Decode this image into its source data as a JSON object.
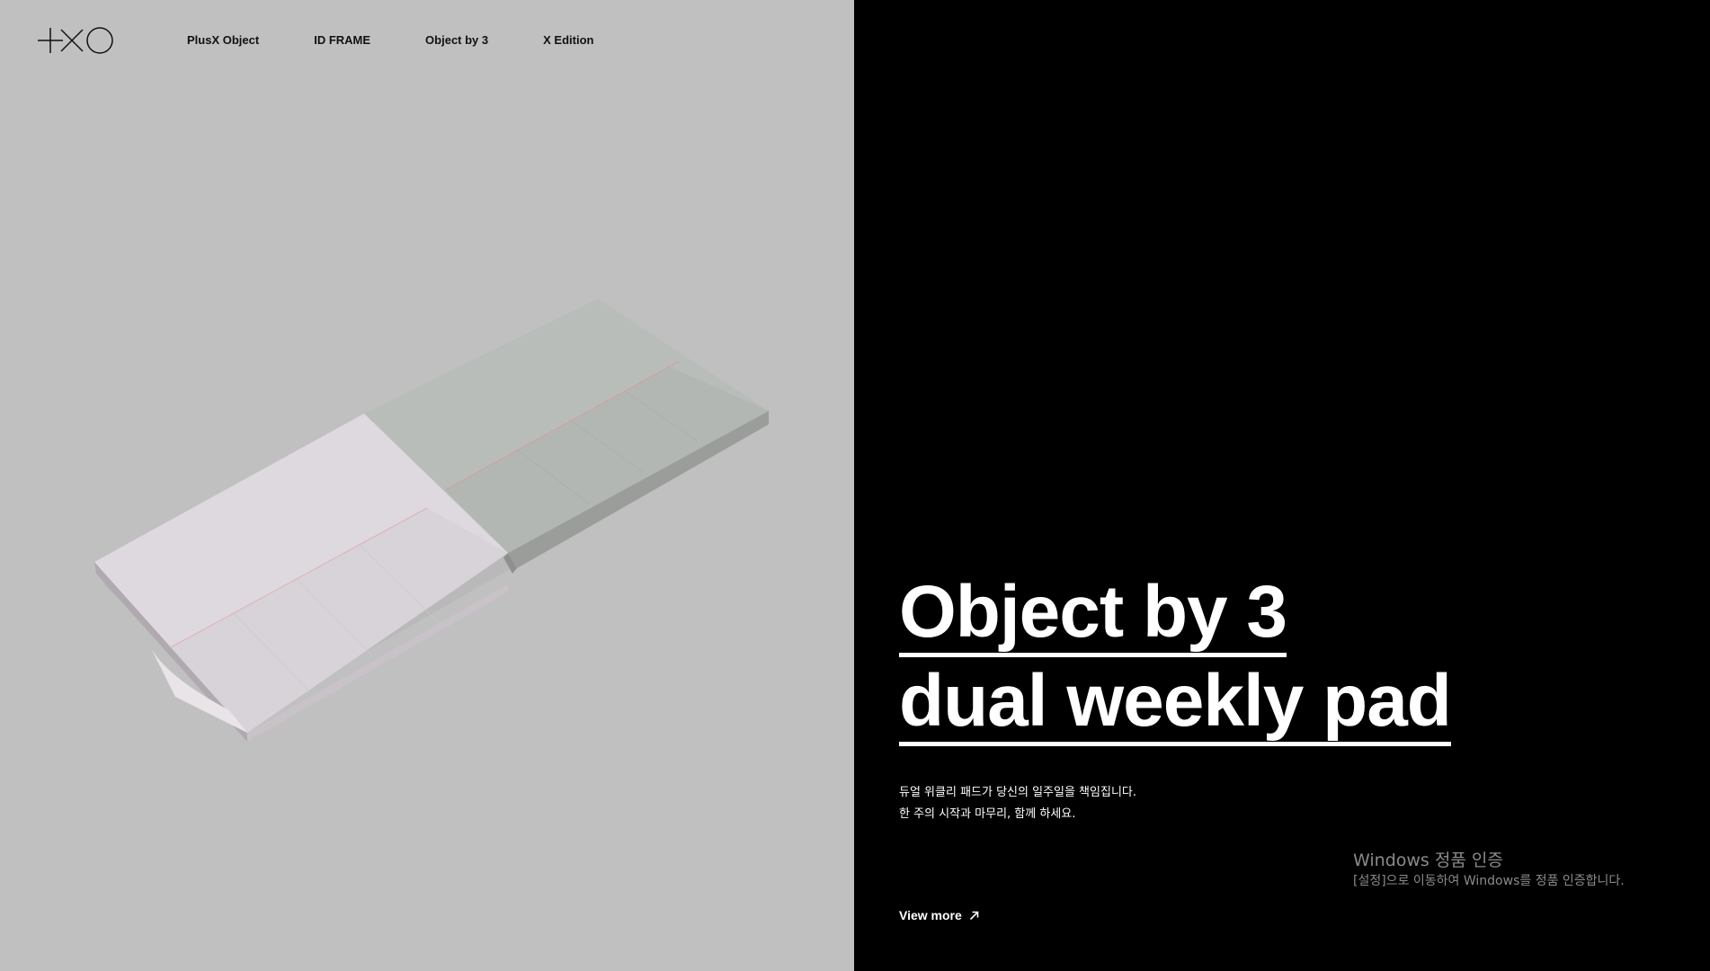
{
  "header": {
    "nav": [
      {
        "label": "PlusX Object"
      },
      {
        "label": "ID FRAME"
      },
      {
        "label": "Object by 3"
      },
      {
        "label": "X Edition"
      }
    ]
  },
  "logo": {
    "alt": "+XO",
    "icon": "plusx-logo"
  },
  "hero": {
    "title_line1": "Object by 3",
    "title_line2": "dual weekly pad",
    "description_line1": "듀얼 위클리 패드가 당신의 일주일을 책임집니다.",
    "description_line2": "한 주의 시작과 마무리, 함께 하세요.",
    "view_more": "View more"
  },
  "watermark": {
    "title": "Windows 정품 인증",
    "subtitle": "[설정]으로 이동하여 Windows를 정품 인증합니다."
  },
  "colors": {
    "left_bg": "#c0c0c0",
    "right_bg": "#000000",
    "text_light": "#ffffff",
    "text_dark": "#111111"
  }
}
